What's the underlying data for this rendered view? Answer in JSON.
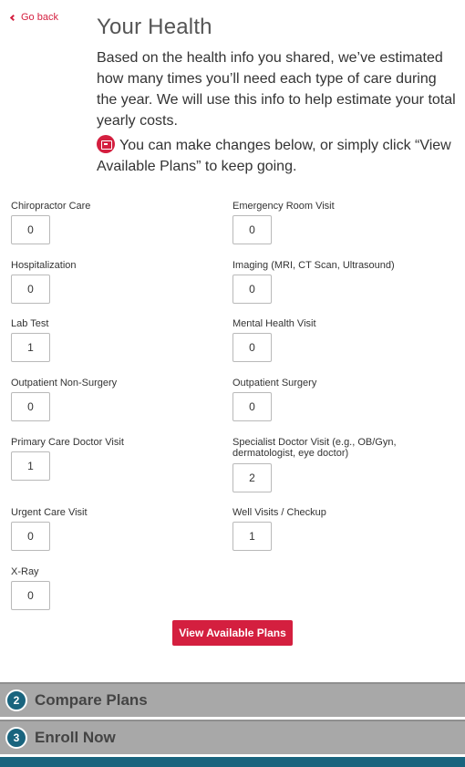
{
  "nav": {
    "back_label": "Go back"
  },
  "header": {
    "title": "Your Health",
    "intro": "Based on the health info you shared, we’ve estimated how many times you’ll need each type of care during the year. We will use this info to help estimate your total yearly costs.",
    "note": "You can make changes below, or simply click “View Available Plans” to keep going."
  },
  "fields": [
    {
      "label": "Chiropractor Care",
      "value": "0"
    },
    {
      "label": "Emergency Room Visit",
      "value": "0"
    },
    {
      "label": "Hospitalization",
      "value": "0"
    },
    {
      "label": "Imaging (MRI, CT Scan, Ultrasound)",
      "value": "0"
    },
    {
      "label": "Lab Test",
      "value": "1"
    },
    {
      "label": "Mental Health Visit",
      "value": "0"
    },
    {
      "label": "Outpatient Non-Surgery",
      "value": "0"
    },
    {
      "label": "Outpatient Surgery",
      "value": "0"
    },
    {
      "label": "Primary Care Doctor Visit",
      "value": "1"
    },
    {
      "label": "Specialist Doctor Visit (e.g., OB/Gyn, dermatologist, eye doctor)",
      "value": "2"
    },
    {
      "label": "Urgent Care Visit",
      "value": "0"
    },
    {
      "label": "Well Visits / Checkup",
      "value": "1"
    },
    {
      "label": "X-Ray",
      "value": "0"
    }
  ],
  "cta": {
    "label": "View Available Plans"
  },
  "steps": [
    {
      "number": "2",
      "label": "Compare Plans"
    },
    {
      "number": "3",
      "label": "Enroll Now"
    }
  ],
  "colors": {
    "accent": "#d41f3f",
    "step_circle": "#19647e",
    "step_bar": "#a8a8a8"
  }
}
